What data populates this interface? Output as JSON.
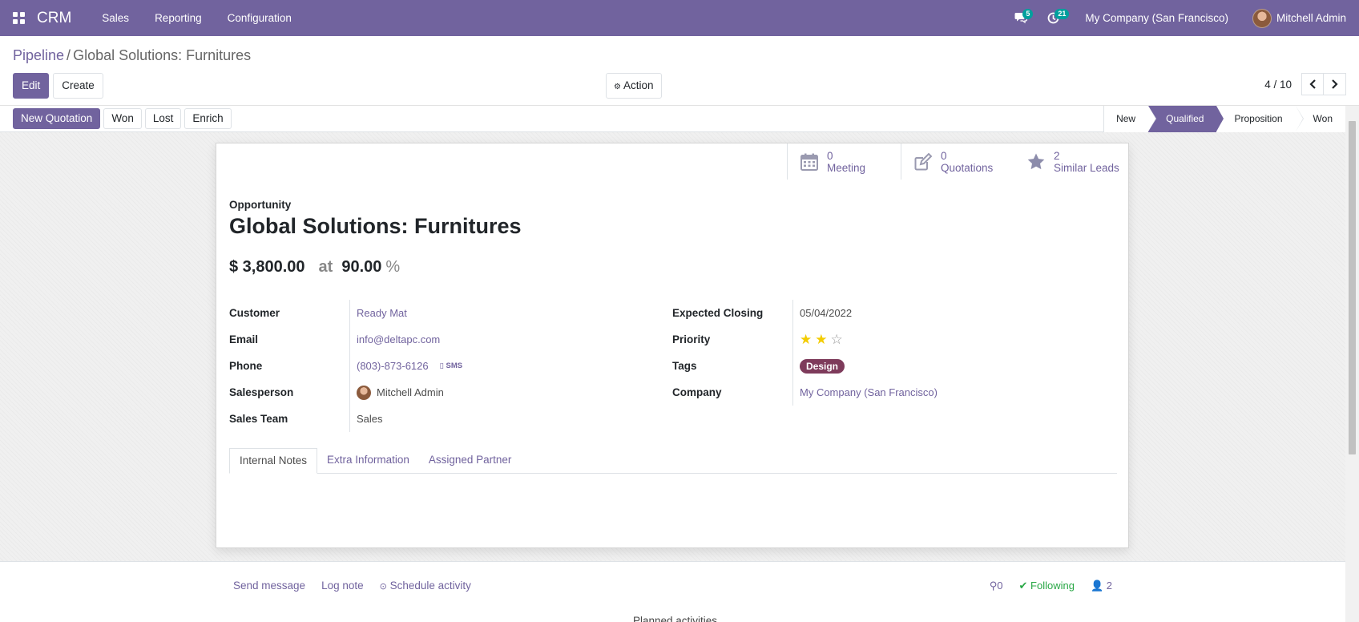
{
  "navbar": {
    "brand": "CRM",
    "menu": [
      "Sales",
      "Reporting",
      "Configuration"
    ],
    "messages_count": "5",
    "activities_count": "21",
    "company": "My Company (San Francisco)",
    "user": "Mitchell Admin"
  },
  "breadcrumb": {
    "parent": "Pipeline",
    "separator": "/",
    "current": "Global Solutions: Furnitures"
  },
  "control": {
    "edit": "Edit",
    "create": "Create",
    "action": "Action",
    "pager_value": "4 / 10"
  },
  "statusbar": {
    "buttons": [
      "New Quotation",
      "Won",
      "Lost",
      "Enrich"
    ],
    "stages": [
      {
        "label": "New",
        "active": false
      },
      {
        "label": "Qualified",
        "active": true
      },
      {
        "label": "Proposition",
        "active": false
      },
      {
        "label": "Won",
        "active": false
      }
    ]
  },
  "smart_buttons": [
    {
      "value": "0",
      "label": "Meeting",
      "icon": "calendar-icon"
    },
    {
      "value": "0",
      "label": "Quotations",
      "icon": "pencil-square-icon"
    },
    {
      "value": "2",
      "label": "Similar Leads",
      "icon": "star-icon"
    }
  ],
  "form": {
    "kind_label": "Opportunity",
    "title": "Global Solutions: Furnitures",
    "expected_revenue": "$ 3,800.00",
    "at": "at",
    "probability": "90.00",
    "percent_sign": "%",
    "left_fields": {
      "customer": {
        "label": "Customer",
        "value": "Ready Mat"
      },
      "email": {
        "label": "Email",
        "value": "info@deltapc.com"
      },
      "phone": {
        "label": "Phone",
        "value": "(803)-873-6126",
        "sms": "SMS"
      },
      "salesperson": {
        "label": "Salesperson",
        "value": "Mitchell Admin"
      },
      "sales_team": {
        "label": "Sales Team",
        "value": "Sales"
      }
    },
    "right_fields": {
      "expected_closing": {
        "label": "Expected Closing",
        "value": "05/04/2022"
      },
      "priority": {
        "label": "Priority",
        "stars_filled": 2,
        "stars_total": 3
      },
      "tags": {
        "label": "Tags",
        "value": "Design"
      },
      "company": {
        "label": "Company",
        "value": "My Company (San Francisco)"
      }
    },
    "tabs": [
      "Internal Notes",
      "Extra Information",
      "Assigned Partner"
    ]
  },
  "chatter": {
    "send_message": "Send message",
    "log_note": "Log note",
    "schedule_activity": "Schedule activity",
    "attachments_count": "0",
    "following": "Following",
    "followers_count": "2",
    "planned_activities": "Planned activities"
  },
  "colors": {
    "brand": "#71639e",
    "tag_design": "#7e3b5b",
    "star": "#f3cc00",
    "following": "#28a745",
    "badge": "#00a09d"
  }
}
